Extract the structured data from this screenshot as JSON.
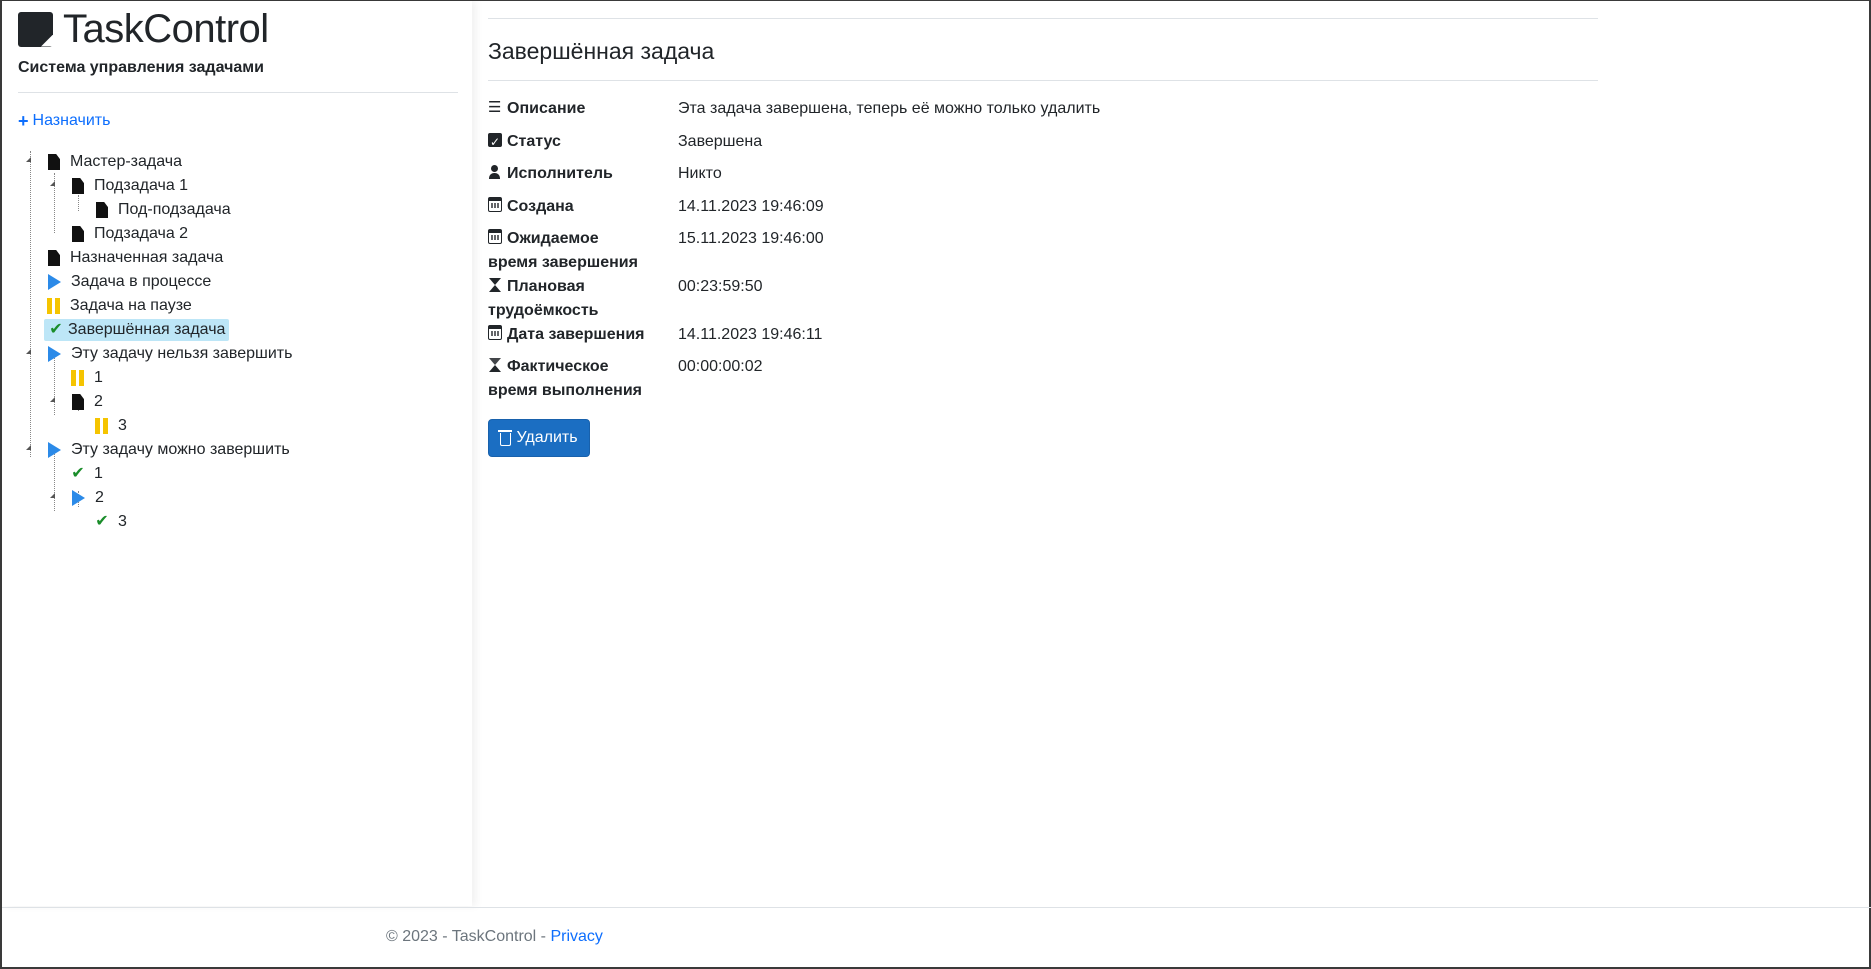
{
  "app": {
    "title": "TaskControl",
    "subtitle": "Система управления задачами",
    "assign_label": "Назначить"
  },
  "tree": [
    {
      "label": "Мастер-задача",
      "icon": "file-icon",
      "level": 0
    },
    {
      "label": "Подзадача 1",
      "icon": "file-icon",
      "level": 1
    },
    {
      "label": "Под-подзадача",
      "icon": "file-icon",
      "level": 2
    },
    {
      "label": "Подзадача 2",
      "icon": "file-icon",
      "level": 1
    },
    {
      "label": "Назначенная задача",
      "icon": "file-icon",
      "level": 0
    },
    {
      "label": "Задача в процессе",
      "icon": "play-icon",
      "level": 0
    },
    {
      "label": "Задача на паузе",
      "icon": "pause-icon",
      "level": 0
    },
    {
      "label": "Завершённая задача",
      "icon": "check-icon",
      "level": 0,
      "selected": true
    },
    {
      "label": "Эту задачу нельзя завершить",
      "icon": "play-icon",
      "level": 0
    },
    {
      "label": "1",
      "icon": "pause-icon",
      "level": 1
    },
    {
      "label": "2",
      "icon": "file-icon",
      "level": 1
    },
    {
      "label": "3",
      "icon": "pause-icon",
      "level": 2
    },
    {
      "label": "Эту задачу можно завершить",
      "icon": "play-icon",
      "level": 0
    },
    {
      "label": "1",
      "icon": "check-icon",
      "level": 1
    },
    {
      "label": "2",
      "icon": "play-icon",
      "level": 1
    },
    {
      "label": "3",
      "icon": "check-icon",
      "level": 2
    }
  ],
  "task": {
    "title": "Завершённая задача",
    "fields": [
      {
        "key": "Описание",
        "value": "Эта задача завершена, теперь её можно только удалить",
        "icon": "list-icon"
      },
      {
        "key": "Статус",
        "value": "Завершена",
        "icon": "check-square-icon"
      },
      {
        "key": "Исполнитель",
        "value": "Никто",
        "icon": "user-icon"
      },
      {
        "key": "Создана",
        "value": "14.11.2023 19:46:09",
        "icon": "calendar-icon"
      },
      {
        "key": "Ожидаемое время завершения",
        "key_line1": "Ожидаемое",
        "key_line2": "время завершения",
        "value": "15.11.2023 19:46:00",
        "icon": "calendar-icon"
      },
      {
        "key": "Плановая трудоёмкость",
        "key_line1": "Плановая",
        "key_line2": "трудоёмкость",
        "value": "00:23:59:50",
        "icon": "hourglass-icon"
      },
      {
        "key": "Дата завершения",
        "value": "14.11.2023 19:46:11",
        "icon": "calendar-icon"
      },
      {
        "key": "Фактическое время выполнения",
        "key_line1": "Фактическое",
        "key_line2": "время выполнения",
        "value": "00:00:00:02",
        "icon": "hourglass-icon"
      }
    ],
    "delete_label": "Удалить"
  },
  "footer": {
    "copyright": "© 2023 - TaskControl - ",
    "privacy_label": "Privacy"
  },
  "colors": {
    "accent": "#0d6efd",
    "button": "#1b6ec2",
    "selected_bg": "#bde6f7",
    "play": "#2b8ae8",
    "pause": "#f5c400",
    "check": "#1a8d2a"
  }
}
